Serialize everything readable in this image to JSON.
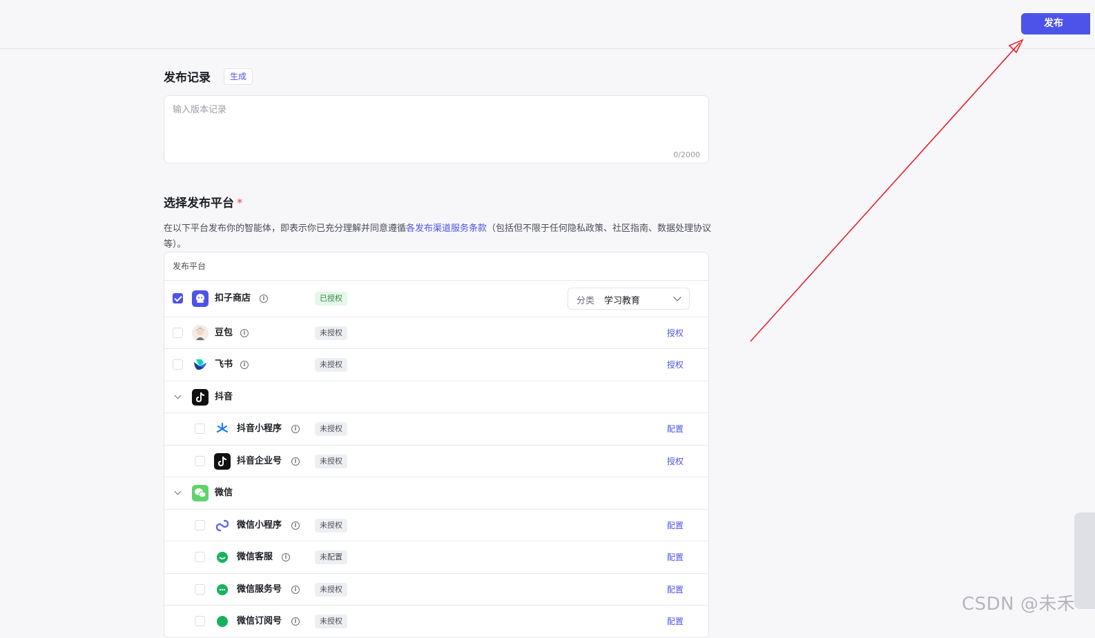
{
  "toolbar": {
    "publish_label": "发布"
  },
  "record": {
    "title": "发布记录",
    "generate_label": "生成",
    "placeholder": "输入版本记录",
    "counter": "0/2000"
  },
  "platform": {
    "title": "选择发布平台",
    "required": "*",
    "desc_prefix": "在以下平台发布你的智能体，即表示你已充分理解并同意遵循",
    "desc_link": "各发布渠道服务条款",
    "desc_suffix": "（包括但不限于任何隐私政策、社区指南、数据处理协议等）。",
    "table_header": "发布平台",
    "category_label": "分类",
    "category_value": "学习教育",
    "rows": [
      {
        "name": "扣子商店",
        "status": "已授权",
        "action": ""
      },
      {
        "name": "豆包",
        "status": "未授权",
        "action": "授权"
      },
      {
        "name": "飞书",
        "status": "未授权",
        "action": "授权"
      },
      {
        "name": "抖音",
        "status": "",
        "action": ""
      },
      {
        "name": "抖音小程序",
        "status": "未授权",
        "action": "配置"
      },
      {
        "name": "抖音企业号",
        "status": "未授权",
        "action": "授权"
      },
      {
        "name": "微信",
        "status": "",
        "action": ""
      },
      {
        "name": "微信小程序",
        "status": "未授权",
        "action": "配置"
      },
      {
        "name": "微信客服",
        "status": "未配置",
        "action": "配置"
      },
      {
        "name": "微信服务号",
        "status": "未授权",
        "action": "配置"
      },
      {
        "name": "微信订阅号",
        "status": "未授权",
        "action": "配置"
      }
    ]
  },
  "watermark": "CSDN @未禾",
  "colors": {
    "accent": "#4d53e8",
    "arrow": "#e8232e",
    "authorized": "#2c8a44"
  },
  "icons": [
    "coze-store-icon",
    "doubao-icon",
    "feishu-icon",
    "douyin-icon",
    "douyin-miniapp-icon",
    "wechat-icon",
    "wechat-miniapp-icon",
    "wechat-service-icon"
  ]
}
